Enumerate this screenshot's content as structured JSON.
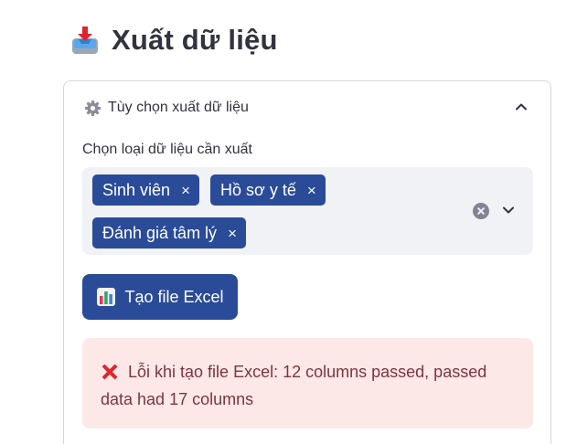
{
  "header": {
    "title": "Xuất dữ liệu",
    "icon": "inbox-tray-icon"
  },
  "expander": {
    "label": "Tùy chọn xuất dữ liệu",
    "icon": "gear-icon",
    "expanded": true
  },
  "multiselect": {
    "label": "Chọn loại dữ liệu cần xuất",
    "selected": [
      {
        "label": "Sinh viên",
        "remove": "×"
      },
      {
        "label": "Hồ sơ y tế",
        "remove": "×"
      },
      {
        "label": "Đánh giá tâm lý",
        "remove": "×"
      }
    ]
  },
  "export_button": {
    "label": "Tạo file Excel",
    "icon": "bar-chart-icon"
  },
  "error": {
    "icon": "cross-mark-icon",
    "line1": "Lỗi khi tạo file Excel: 12 columns passed, passed",
    "line2": "data had 17 columns"
  },
  "colors": {
    "accent": "#2a4b98",
    "text": "#31333f",
    "error_bg": "#fde8e8",
    "error_text": "#7d353b",
    "error_icon": "#e0242e",
    "input_bg": "#f0f2f6",
    "border": "#d6d7dc"
  }
}
